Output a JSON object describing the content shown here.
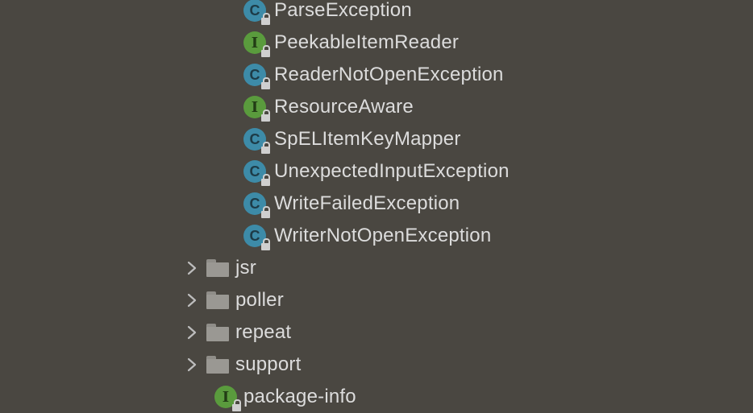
{
  "tree": {
    "classes": [
      {
        "label": "ParseException",
        "kind": "class",
        "icon": "class-icon",
        "badge": "C"
      },
      {
        "label": "PeekableItemReader",
        "kind": "interface",
        "icon": "interface-icon",
        "badge": "I"
      },
      {
        "label": "ReaderNotOpenException",
        "kind": "class",
        "icon": "class-icon",
        "badge": "C"
      },
      {
        "label": "ResourceAware",
        "kind": "interface",
        "icon": "interface-icon",
        "badge": "I"
      },
      {
        "label": "SpELItemKeyMapper",
        "kind": "class",
        "icon": "class-icon",
        "badge": "C"
      },
      {
        "label": "UnexpectedInputException",
        "kind": "class",
        "icon": "class-icon",
        "badge": "C"
      },
      {
        "label": "WriteFailedException",
        "kind": "class",
        "icon": "class-icon",
        "badge": "C"
      },
      {
        "label": "WriterNotOpenException",
        "kind": "class",
        "icon": "class-icon",
        "badge": "C"
      }
    ],
    "folders": [
      {
        "label": "jsr",
        "icon": "folder-icon"
      },
      {
        "label": "poller",
        "icon": "folder-icon"
      },
      {
        "label": "repeat",
        "icon": "folder-icon"
      },
      {
        "label": "support",
        "icon": "folder-icon"
      }
    ],
    "package_info": {
      "label": "package-info",
      "kind": "interface",
      "icon": "interface-icon",
      "badge": "I"
    }
  },
  "colors": {
    "background": "#4a4741",
    "class_badge": "#3d8ba8",
    "interface_badge": "#5a9b3d",
    "folder": "#9a9893",
    "text": "#dcdcdc"
  }
}
